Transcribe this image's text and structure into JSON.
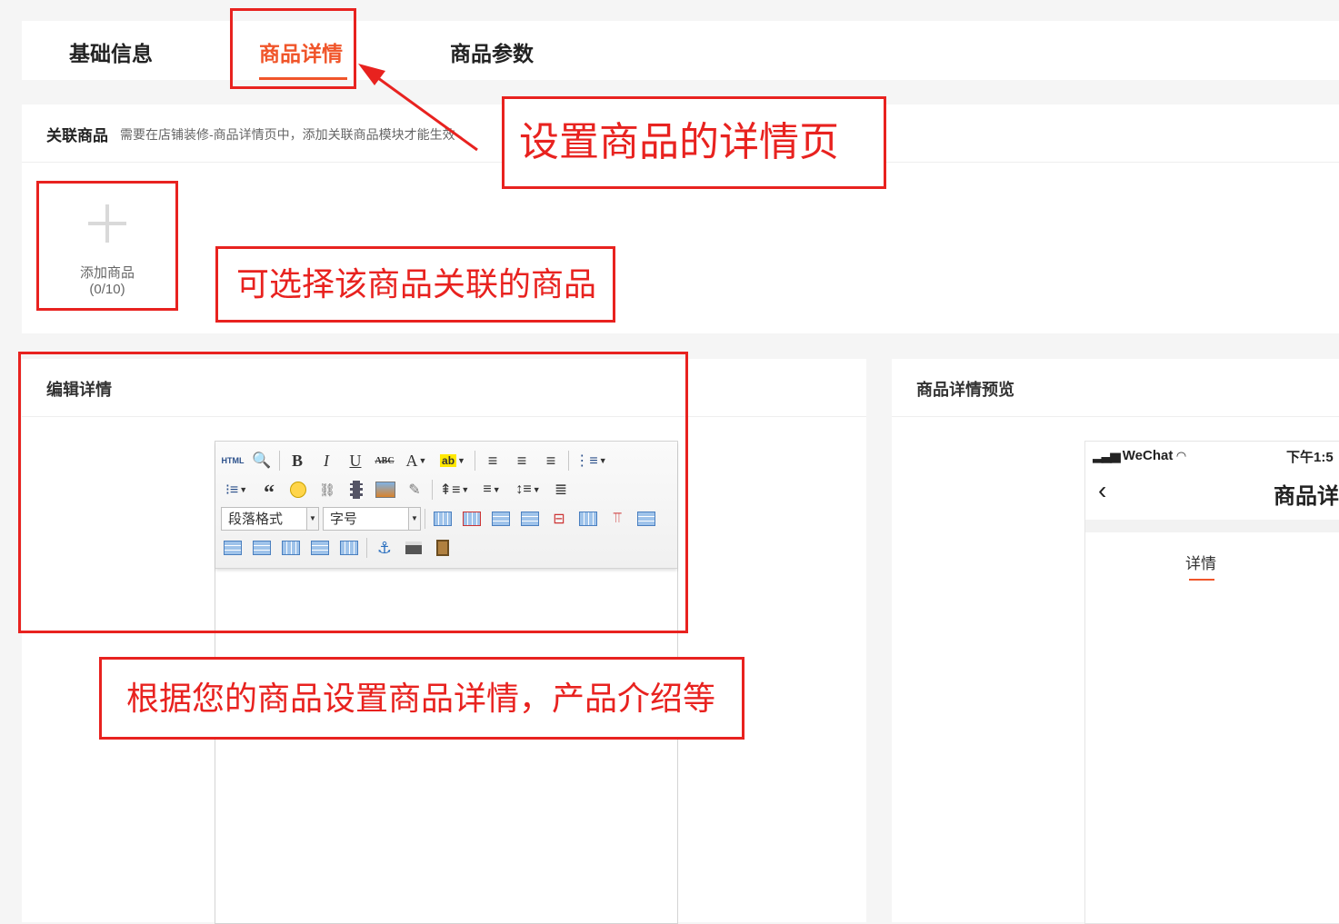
{
  "tabs": [
    {
      "label": "基础信息",
      "active": false
    },
    {
      "label": "商品详情",
      "active": true
    },
    {
      "label": "商品参数",
      "active": false
    }
  ],
  "related": {
    "title": "关联商品",
    "hint": "需要在店铺装修-商品详情页中，添加关联商品模块才能生效",
    "add_label": "添加商品",
    "add_count": "(0/10)"
  },
  "editor": {
    "title": "编辑详情",
    "paragraph_select": "段落格式",
    "size_select": "字号",
    "html_label": "HTML"
  },
  "preview": {
    "title": "商品详情预览",
    "status_left": "WeChat",
    "status_time": "下午1:5",
    "page_title": "商品详",
    "tab_label": "详情"
  },
  "annotations": {
    "detail_page": "设置商品的详情页",
    "related_goods": "可选择该商品关联的商品",
    "set_details": "根据您的商品设置商品详情，产品介绍等"
  },
  "colors": {
    "accent": "#f0552a",
    "annotation_red": "#e8221f"
  }
}
